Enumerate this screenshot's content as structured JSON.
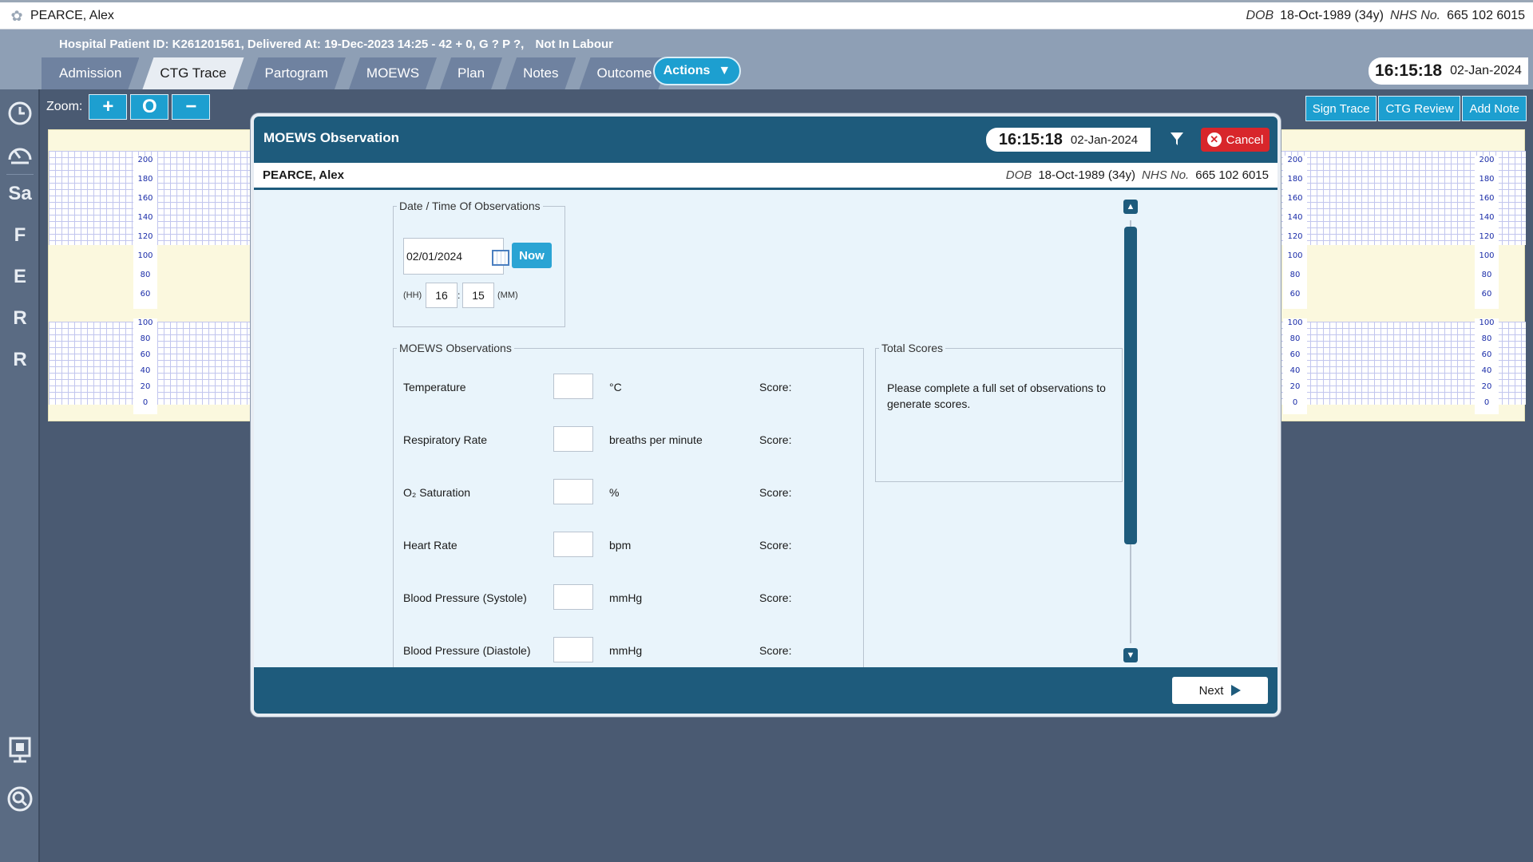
{
  "patient": {
    "name": "PEARCE, Alex",
    "dob_label": "DOB",
    "dob": "18-Oct-1989 (34y)",
    "nhs_label": "NHS No.",
    "nhs": "665 102 6015"
  },
  "header": {
    "info": "Hospital Patient ID: K261201561, Delivered At: 19-Dec-2023 14:25 - 42 + 0, G ? P ?,",
    "status": "Not In Labour",
    "tabs": [
      {
        "label": "Admission"
      },
      {
        "label": "CTG Trace"
      },
      {
        "label": "Partogram"
      },
      {
        "label": "MOEWS"
      },
      {
        "label": "Plan"
      },
      {
        "label": "Notes"
      },
      {
        "label": "Outcome"
      }
    ],
    "active_tab": "CTG Trace",
    "actions_label": "Actions",
    "time": "16:15:18",
    "date": "02-Jan-2024"
  },
  "rail": {
    "letters": [
      "Sa",
      "F",
      "E",
      "R",
      "R"
    ]
  },
  "toolbar": {
    "zoom_label": "Zoom:",
    "zoom_in": "+",
    "zoom_reset": "O",
    "zoom_out": "−",
    "sign_trace": "Sign Trace",
    "ctg_review": "CTG Review",
    "add_note": "Add Note"
  },
  "ctg": {
    "fhr_ticks": [
      "200",
      "180",
      "160",
      "140",
      "120",
      "100",
      "80",
      "60"
    ],
    "toco_ticks": [
      "100",
      "80",
      "60",
      "40",
      "20",
      "0"
    ]
  },
  "modal": {
    "title": "MOEWS Observation",
    "time": "16:15:18",
    "date": "02-Jan-2024",
    "cancel_label": "Cancel",
    "datetime_legend": "Date / Time Of Observations",
    "date_value": "02/01/2024",
    "now_label": "Now",
    "hh_label": "(HH)",
    "hh_value": "16",
    "mm_label": "(MM)",
    "mm_value": "15",
    "obs_legend": "MOEWS Observations",
    "observations": [
      {
        "label": "Temperature",
        "unit": "°C",
        "score_label": "Score:"
      },
      {
        "label": "Respiratory Rate",
        "unit": "breaths per minute",
        "score_label": "Score:"
      },
      {
        "label": "O₂ Saturation",
        "unit": "%",
        "score_label": "Score:"
      },
      {
        "label": "Heart Rate",
        "unit": "bpm",
        "score_label": "Score:"
      },
      {
        "label": "Blood Pressure (Systole)",
        "unit": "mmHg",
        "score_label": "Score:"
      },
      {
        "label": "Blood Pressure (Diastole)",
        "unit": "mmHg",
        "score_label": "Score:"
      }
    ],
    "totals_legend": "Total Scores",
    "totals_text": "Please complete a full set of observations to generate scores.",
    "next_label": "Next"
  }
}
